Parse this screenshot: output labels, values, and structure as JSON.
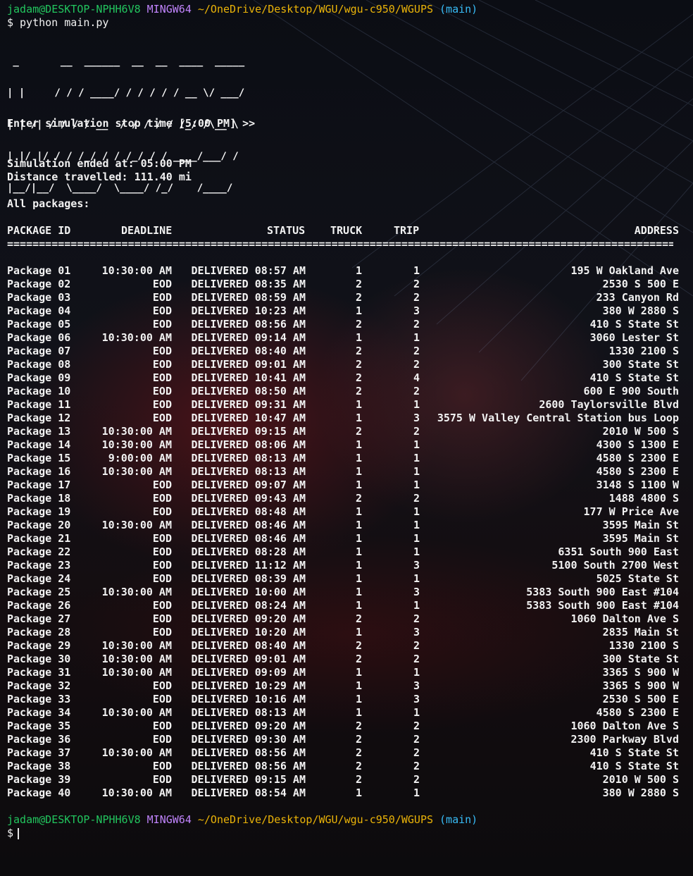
{
  "prompt": {
    "user": "jadam@DESKTOP-NPHH6V8",
    "host": "MINGW64",
    "path": "~/OneDrive/Desktop/WGU/wgu-c950/WGUPS",
    "branch": "(main)",
    "symbol": "$"
  },
  "command": "python main.py",
  "logo_lines": [
    " _       __  ______  __  __  ____  _____",
    "| |     / / / ____/ / / / / / __ \\/ ___/",
    "| | /| / / / / __  / / / / / /_/ /\\__ \\ ",
    "| |/ |/ / / /_/ / / /_/ / / ____/___/ / ",
    "|__/|__/  \\____/  \\____/ /_/    /____/  "
  ],
  "stop_prompt": "Enter simulation stop time [5:00 PM] >>",
  "sim_ended": "Simulation ended at: 05:00 PM",
  "distance": "Distance travelled: 111.40 mi",
  "all_packages": "All packages:",
  "headers": {
    "id": "PACKAGE ID",
    "deadline": "DEADLINE",
    "status": "STATUS",
    "truck": "TRUCK",
    "trip": "TRIP",
    "address": "ADDRESS"
  },
  "rule": "==========================================================================================================",
  "packages": [
    {
      "id": "Package 01",
      "deadline": "10:30:00 AM",
      "status": "DELIVERED 08:57 AM",
      "truck": "1",
      "trip": "1",
      "address": "195 W Oakland Ave"
    },
    {
      "id": "Package 02",
      "deadline": "EOD",
      "status": "DELIVERED 08:35 AM",
      "truck": "2",
      "trip": "2",
      "address": "2530 S 500 E"
    },
    {
      "id": "Package 03",
      "deadline": "EOD",
      "status": "DELIVERED 08:59 AM",
      "truck": "2",
      "trip": "2",
      "address": "233 Canyon Rd"
    },
    {
      "id": "Package 04",
      "deadline": "EOD",
      "status": "DELIVERED 10:23 AM",
      "truck": "1",
      "trip": "3",
      "address": "380 W 2880 S"
    },
    {
      "id": "Package 05",
      "deadline": "EOD",
      "status": "DELIVERED 08:56 AM",
      "truck": "2",
      "trip": "2",
      "address": "410 S State St"
    },
    {
      "id": "Package 06",
      "deadline": "10:30:00 AM",
      "status": "DELIVERED 09:14 AM",
      "truck": "1",
      "trip": "1",
      "address": "3060 Lester St"
    },
    {
      "id": "Package 07",
      "deadline": "EOD",
      "status": "DELIVERED 08:40 AM",
      "truck": "2",
      "trip": "2",
      "address": "1330 2100 S"
    },
    {
      "id": "Package 08",
      "deadline": "EOD",
      "status": "DELIVERED 09:01 AM",
      "truck": "2",
      "trip": "2",
      "address": "300 State St"
    },
    {
      "id": "Package 09",
      "deadline": "EOD",
      "status": "DELIVERED 10:41 AM",
      "truck": "2",
      "trip": "4",
      "address": "410 S State St"
    },
    {
      "id": "Package 10",
      "deadline": "EOD",
      "status": "DELIVERED 08:50 AM",
      "truck": "2",
      "trip": "2",
      "address": "600 E 900 South"
    },
    {
      "id": "Package 11",
      "deadline": "EOD",
      "status": "DELIVERED 09:31 AM",
      "truck": "1",
      "trip": "1",
      "address": "2600 Taylorsville Blvd"
    },
    {
      "id": "Package 12",
      "deadline": "EOD",
      "status": "DELIVERED 10:47 AM",
      "truck": "1",
      "trip": "3",
      "address": "3575 W Valley Central Station bus Loop"
    },
    {
      "id": "Package 13",
      "deadline": "10:30:00 AM",
      "status": "DELIVERED 09:15 AM",
      "truck": "2",
      "trip": "2",
      "address": "2010 W 500 S"
    },
    {
      "id": "Package 14",
      "deadline": "10:30:00 AM",
      "status": "DELIVERED 08:06 AM",
      "truck": "1",
      "trip": "1",
      "address": "4300 S 1300 E"
    },
    {
      "id": "Package 15",
      "deadline": "9:00:00 AM",
      "status": "DELIVERED 08:13 AM",
      "truck": "1",
      "trip": "1",
      "address": "4580 S 2300 E"
    },
    {
      "id": "Package 16",
      "deadline": "10:30:00 AM",
      "status": "DELIVERED 08:13 AM",
      "truck": "1",
      "trip": "1",
      "address": "4580 S 2300 E"
    },
    {
      "id": "Package 17",
      "deadline": "EOD",
      "status": "DELIVERED 09:07 AM",
      "truck": "1",
      "trip": "1",
      "address": "3148 S 1100 W"
    },
    {
      "id": "Package 18",
      "deadline": "EOD",
      "status": "DELIVERED 09:43 AM",
      "truck": "2",
      "trip": "2",
      "address": "1488 4800 S"
    },
    {
      "id": "Package 19",
      "deadline": "EOD",
      "status": "DELIVERED 08:48 AM",
      "truck": "1",
      "trip": "1",
      "address": "177 W Price Ave"
    },
    {
      "id": "Package 20",
      "deadline": "10:30:00 AM",
      "status": "DELIVERED 08:46 AM",
      "truck": "1",
      "trip": "1",
      "address": "3595 Main St"
    },
    {
      "id": "Package 21",
      "deadline": "EOD",
      "status": "DELIVERED 08:46 AM",
      "truck": "1",
      "trip": "1",
      "address": "3595 Main St"
    },
    {
      "id": "Package 22",
      "deadline": "EOD",
      "status": "DELIVERED 08:28 AM",
      "truck": "1",
      "trip": "1",
      "address": "6351 South 900 East"
    },
    {
      "id": "Package 23",
      "deadline": "EOD",
      "status": "DELIVERED 11:12 AM",
      "truck": "1",
      "trip": "3",
      "address": "5100 South 2700 West"
    },
    {
      "id": "Package 24",
      "deadline": "EOD",
      "status": "DELIVERED 08:39 AM",
      "truck": "1",
      "trip": "1",
      "address": "5025 State St"
    },
    {
      "id": "Package 25",
      "deadline": "10:30:00 AM",
      "status": "DELIVERED 10:00 AM",
      "truck": "1",
      "trip": "3",
      "address": "5383 South 900 East #104"
    },
    {
      "id": "Package 26",
      "deadline": "EOD",
      "status": "DELIVERED 08:24 AM",
      "truck": "1",
      "trip": "1",
      "address": "5383 South 900 East #104"
    },
    {
      "id": "Package 27",
      "deadline": "EOD",
      "status": "DELIVERED 09:20 AM",
      "truck": "2",
      "trip": "2",
      "address": "1060 Dalton Ave S"
    },
    {
      "id": "Package 28",
      "deadline": "EOD",
      "status": "DELIVERED 10:20 AM",
      "truck": "1",
      "trip": "3",
      "address": "2835 Main St"
    },
    {
      "id": "Package 29",
      "deadline": "10:30:00 AM",
      "status": "DELIVERED 08:40 AM",
      "truck": "2",
      "trip": "2",
      "address": "1330 2100 S"
    },
    {
      "id": "Package 30",
      "deadline": "10:30:00 AM",
      "status": "DELIVERED 09:01 AM",
      "truck": "2",
      "trip": "2",
      "address": "300 State St"
    },
    {
      "id": "Package 31",
      "deadline": "10:30:00 AM",
      "status": "DELIVERED 09:09 AM",
      "truck": "1",
      "trip": "1",
      "address": "3365 S 900 W"
    },
    {
      "id": "Package 32",
      "deadline": "EOD",
      "status": "DELIVERED 10:29 AM",
      "truck": "1",
      "trip": "3",
      "address": "3365 S 900 W"
    },
    {
      "id": "Package 33",
      "deadline": "EOD",
      "status": "DELIVERED 10:16 AM",
      "truck": "1",
      "trip": "3",
      "address": "2530 S 500 E"
    },
    {
      "id": "Package 34",
      "deadline": "10:30:00 AM",
      "status": "DELIVERED 08:13 AM",
      "truck": "1",
      "trip": "1",
      "address": "4580 S 2300 E"
    },
    {
      "id": "Package 35",
      "deadline": "EOD",
      "status": "DELIVERED 09:20 AM",
      "truck": "2",
      "trip": "2",
      "address": "1060 Dalton Ave S"
    },
    {
      "id": "Package 36",
      "deadline": "EOD",
      "status": "DELIVERED 09:30 AM",
      "truck": "2",
      "trip": "2",
      "address": "2300 Parkway Blvd"
    },
    {
      "id": "Package 37",
      "deadline": "10:30:00 AM",
      "status": "DELIVERED 08:56 AM",
      "truck": "2",
      "trip": "2",
      "address": "410 S State St"
    },
    {
      "id": "Package 38",
      "deadline": "EOD",
      "status": "DELIVERED 08:56 AM",
      "truck": "2",
      "trip": "2",
      "address": "410 S State St"
    },
    {
      "id": "Package 39",
      "deadline": "EOD",
      "status": "DELIVERED 09:15 AM",
      "truck": "2",
      "trip": "2",
      "address": "2010 W 500 S"
    },
    {
      "id": "Package 40",
      "deadline": "10:30:00 AM",
      "status": "DELIVERED 08:54 AM",
      "truck": "1",
      "trip": "1",
      "address": "380 W 2880 S"
    }
  ],
  "colors": {
    "user": "#22c55e",
    "host": "#c084fc",
    "path": "#eab308",
    "branch": "#38bdf8",
    "text": "#f2f2f2"
  }
}
